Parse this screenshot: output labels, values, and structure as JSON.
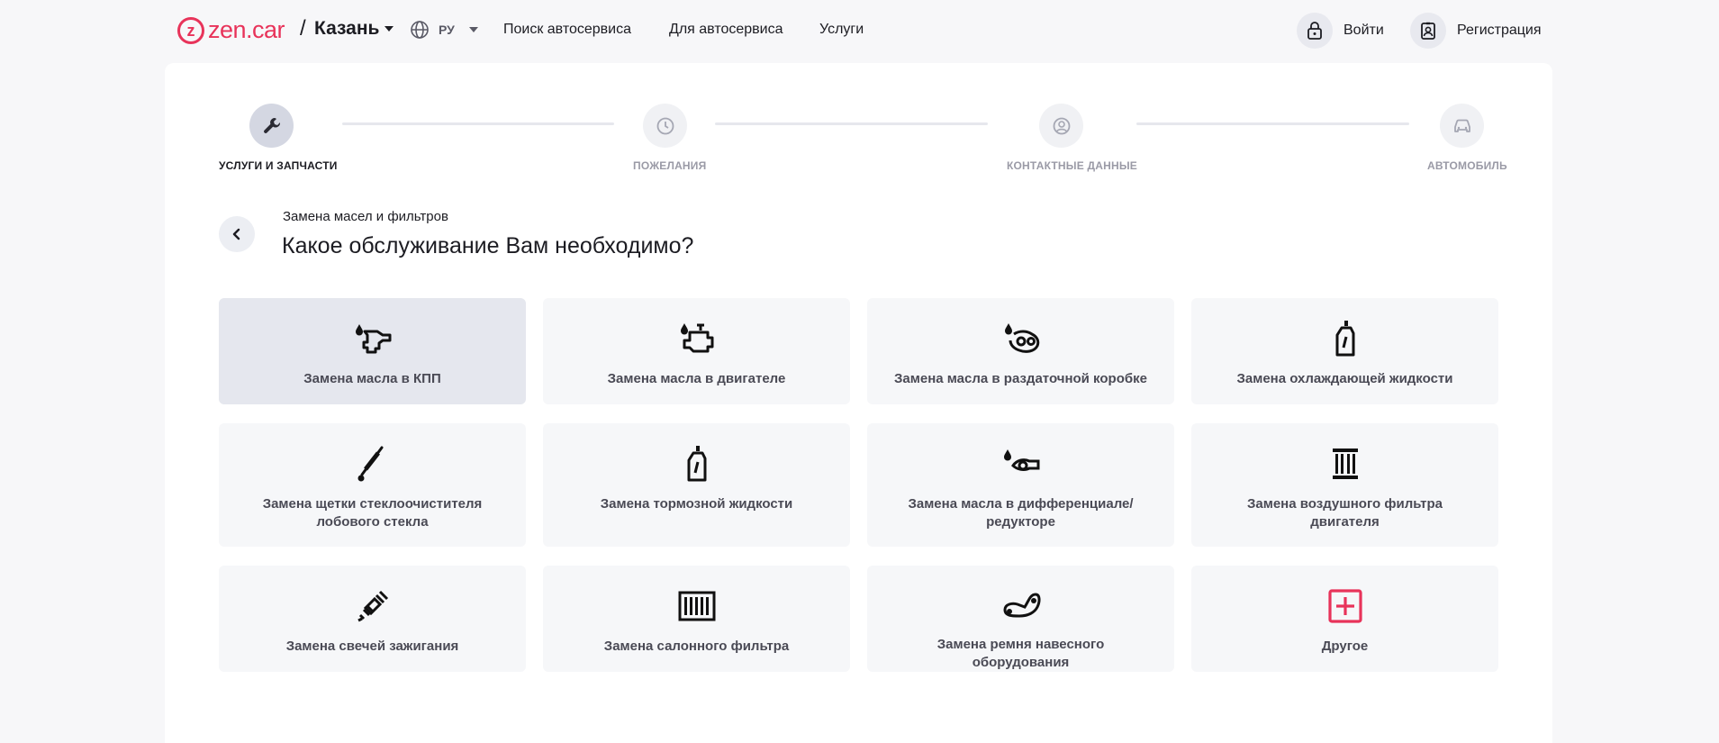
{
  "header": {
    "logo_mark": "z",
    "logo_text": "zen.car",
    "slash": "/",
    "city": "Казань",
    "lang": "РУ",
    "nav": [
      "Поиск автосервиса",
      "Для автосервиса",
      "Услуги"
    ],
    "login": "Войти",
    "register": "Регистрация"
  },
  "steps": [
    {
      "label": "УСЛУГИ И ЗАПЧАСТИ",
      "icon": "wrench-icon",
      "active": true
    },
    {
      "label": "ПОЖЕЛАНИЯ",
      "icon": "clock-icon",
      "active": false
    },
    {
      "label": "КОНТАКТНЫЕ ДАННЫЕ",
      "icon": "user-circle-icon",
      "active": false
    },
    {
      "label": "АВТОМОБИЛЬ",
      "icon": "car-icon",
      "active": false
    }
  ],
  "breadcrumb": "Замена масел и фильтров",
  "title": "Какое обслуживание Вам необходимо?",
  "services": [
    {
      "label": "Замена масла в КПП",
      "icon": "gearbox-oil-icon",
      "selected": true
    },
    {
      "label": "Замена масла в двигателе",
      "icon": "engine-oil-icon",
      "selected": false
    },
    {
      "label": "Замена масла в раздаточной коробке",
      "icon": "transfer-case-oil-icon",
      "selected": false
    },
    {
      "label": "Замена охлаждающей жидкости",
      "icon": "coolant-bottle-icon",
      "selected": false
    },
    {
      "label": "Замена щетки стеклоочистителя лобового стекла",
      "icon": "wiper-icon",
      "selected": false
    },
    {
      "label": "Замена тормозной жидкости",
      "icon": "brake-fluid-bottle-icon",
      "selected": false
    },
    {
      "label": "Замена масла в дифференциале/редукторе",
      "icon": "differential-oil-icon",
      "selected": false
    },
    {
      "label": "Замена воздушного фильтра двигателя",
      "icon": "air-filter-icon",
      "selected": false
    },
    {
      "label": "Замена свечей зажигания",
      "icon": "spark-plug-icon",
      "selected": false
    },
    {
      "label": "Замена салонного фильтра",
      "icon": "cabin-filter-icon",
      "selected": false
    },
    {
      "label": "Замена ремня навесного оборудования",
      "icon": "belt-icon",
      "selected": false
    },
    {
      "label": "Другое",
      "icon": "plus-square-icon",
      "selected": false
    }
  ],
  "colors": {
    "brand": "#e8335a",
    "accent_bg": "#e5e7ee"
  }
}
